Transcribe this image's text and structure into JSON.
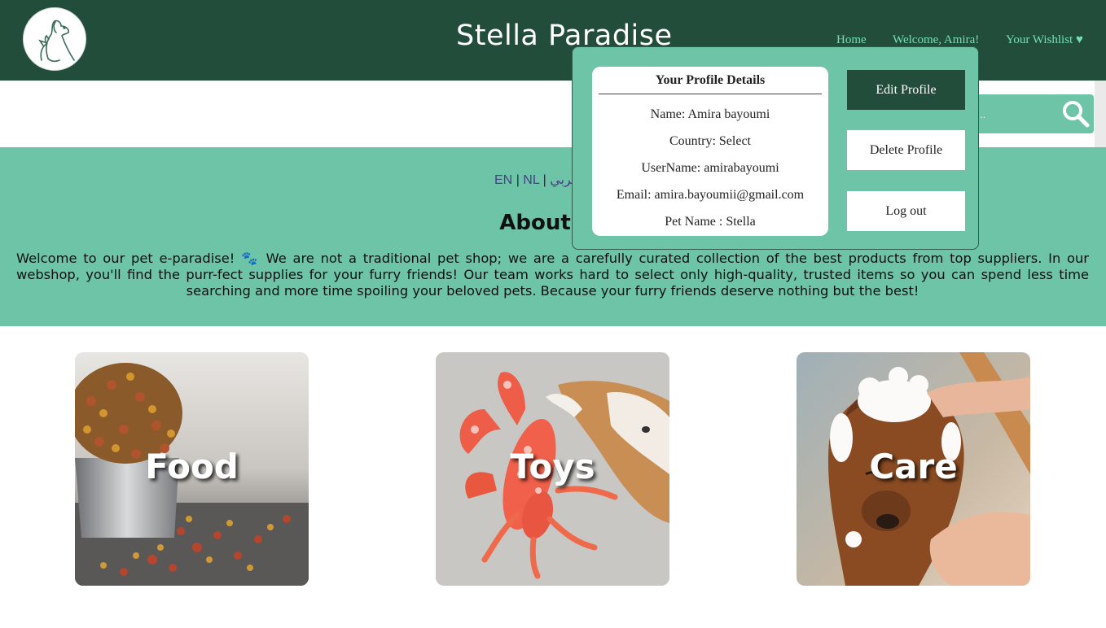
{
  "header": {
    "title": "Stella Paradise",
    "nav": {
      "home": "Home",
      "welcome": "Welcome, Amira!",
      "wishlist": "Your Wishlist ♥"
    }
  },
  "search": {
    "value": "..",
    "icon": "search-icon"
  },
  "languages": {
    "en": "EN",
    "nl": "NL",
    "ar": "عربي",
    "separator": "|"
  },
  "about": {
    "heading": "About",
    "text": "Welcome to our pet e-paradise! 🐾 We are not a traditional pet shop; we are a carefully curated collection of the best products from top suppliers. In our webshop, you'll find the purr-fect supplies for your furry friends! Our team works hard to select only high-quality, trusted items so you can spend less time searching and more time spoiling your beloved pets. Because your furry friends deserve nothing but the best!"
  },
  "categories": [
    {
      "label": "Food"
    },
    {
      "label": "Toys"
    },
    {
      "label": "Care"
    }
  ],
  "profile": {
    "title": "Your Profile Details",
    "name": "Name: Amira bayoumi",
    "country": "Country: Select",
    "username": "UserName: amirabayoumi",
    "email": "Email: amira.bayoumii@gmail.com",
    "pet": "Pet Name : Stella",
    "buttons": {
      "edit": "Edit Profile",
      "delete": "Delete Profile",
      "logout": "Log out"
    }
  },
  "colors": {
    "header_bg": "#234d3b",
    "accent": "#6dc4a6",
    "nav_link": "#72e0b7"
  }
}
